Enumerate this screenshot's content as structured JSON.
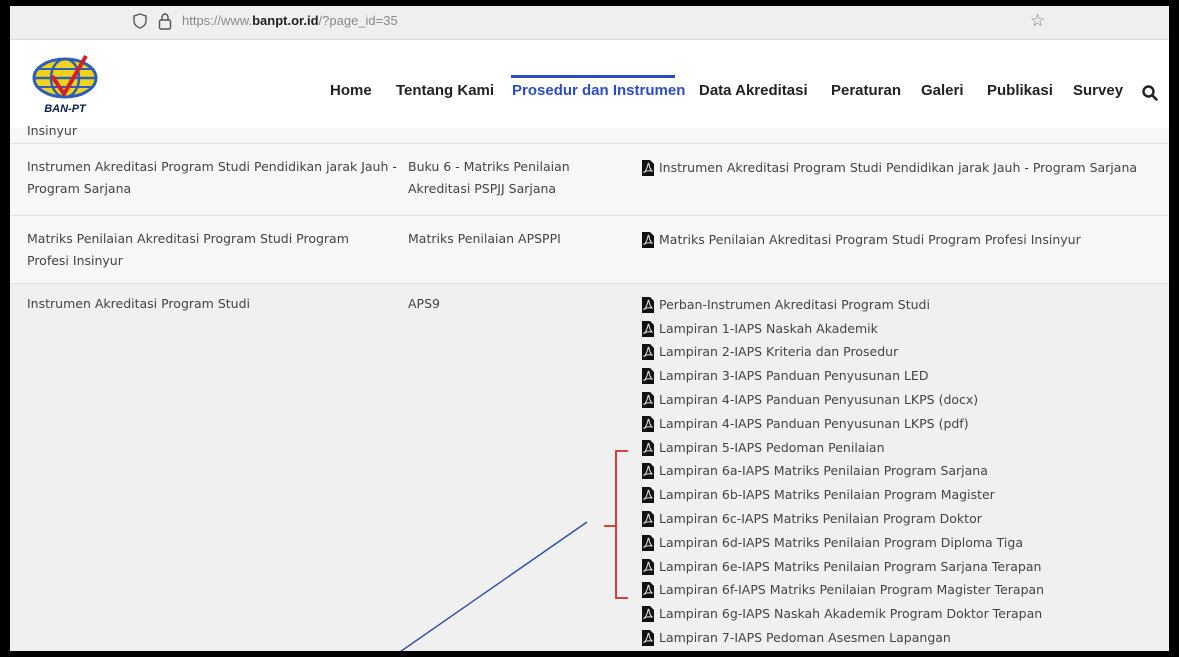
{
  "browser": {
    "url_prefix": "https://www.",
    "url_host": "banpt.or.id",
    "url_path": "/?page_id=35"
  },
  "site": {
    "logo_text": "BAN-PT",
    "nav": [
      "Home",
      "Tentang Kami",
      "Prosedur dan Instrumen",
      "Data Akreditasi",
      "Peraturan",
      "Galeri",
      "Publikasi",
      "Survey"
    ],
    "active_nav": "Prosedur dan Instrumen",
    "accent_color": "#2d4bc5"
  },
  "table": {
    "partial_top_text": "Insinyur",
    "rows": [
      {
        "title": "Instrumen Akreditasi Program Studi Pendidikan jarak Jauh - Program Sarjana",
        "doc": "Buku 6 - Matriks Penilaian Akreditasi PSPJJ Sarjana",
        "files": [
          "Instrumen Akreditasi Program Studi Pendidikan jarak Jauh - Program Sarjana"
        ]
      },
      {
        "title": "Matriks Penilaian Akreditasi Program Studi Program Profesi Insinyur",
        "doc": "Matriks Penilaian APSPPI",
        "files": [
          "Matriks Penilaian Akreditasi Program Studi Program Profesi Insinyur"
        ]
      },
      {
        "title": "Instrumen Akreditasi Program Studi",
        "doc": "APS9",
        "files": [
          "Perban-Instrumen Akreditasi Program Studi",
          "Lampiran 1-IAPS Naskah Akademik",
          "Lampiran 2-IAPS Kriteria dan Prosedur",
          "Lampiran 3-IAPS Panduan Penyusunan LED",
          "Lampiran 4-IAPS Panduan Penyusunan LKPS (docx)",
          "Lampiran 4-IAPS Panduan Penyusunan LKPS (pdf)",
          "Lampiran 5-IAPS Pedoman Penilaian",
          "Lampiran 6a-IAPS Matriks Penilaian Program Sarjana",
          "Lampiran 6b-IAPS Matriks Penilaian Program Magister",
          "Lampiran 6c-IAPS Matriks Penilaian Program Doktor",
          "Lampiran 6d-IAPS Matriks Penilaian Program Diploma Tiga",
          "Lampiran 6e-IAPS Matriks Penilaian Program Sarjana Terapan",
          "Lampiran 6f-IAPS Matriks Penilaian Program Magister Terapan",
          "Lampiran 6g-IAPS Naskah Akademik Program Doktor Terapan",
          "Lampiran 7-IAPS Pedoman Asesmen Lapangan"
        ]
      }
    ]
  },
  "annotation": {
    "bracket_color": "#d42a2a",
    "arrow_color": "#2b4aa8"
  }
}
